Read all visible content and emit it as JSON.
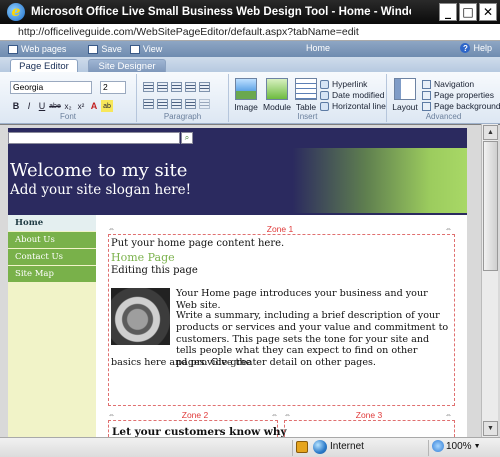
{
  "window": {
    "title": "Microsoft Office Live Small Business Web Design Tool - Home - Windows Internet Explorer",
    "controls": {
      "minimize": "_",
      "maximize": "□",
      "close": "✕"
    }
  },
  "address_bar": {
    "url": "http://officeliveguide.com/WebSitePageEditor/default.aspx?tabName=edit"
  },
  "app_toolbar": {
    "web_pages": "Web pages",
    "save": "Save",
    "view": "View",
    "page_name": "Home",
    "help": "Help"
  },
  "tabs": [
    {
      "label": "Page Editor",
      "active": true
    },
    {
      "label": "Site Designer",
      "active": false
    }
  ],
  "ribbon": {
    "font": {
      "family": "Georgia",
      "size": "2",
      "group_label": "Font",
      "buttons": [
        "B",
        "I",
        "U",
        "abe",
        "x₂",
        "x²",
        "A",
        "ab"
      ]
    },
    "paragraph": {
      "group_label": "Paragraph"
    },
    "insert": {
      "group_label": "Insert",
      "image": "Image",
      "module": "Module",
      "table": "Table",
      "hyperlink": "Hyperlink",
      "date_modified": "Date modified",
      "horizontal_line": "Horizontal line"
    },
    "advanced": {
      "group_label": "Advanced",
      "layout": "Layout",
      "navigation": "Navigation",
      "page_properties": "Page properties",
      "page_background": "Page background"
    }
  },
  "site": {
    "title": "Welcome to my site",
    "slogan": "Add your site slogan here!",
    "nav": [
      {
        "label": "Home",
        "selected": true
      },
      {
        "label": "About Us",
        "selected": false
      },
      {
        "label": "Contact Us",
        "selected": false
      },
      {
        "label": "Site Map",
        "selected": false
      }
    ],
    "zones": {
      "zone1": "Zone 1",
      "zone2": "Zone 2",
      "zone3": "Zone 3"
    },
    "zone1_content": {
      "placeholder": "Put your home page content here.",
      "heading": "Home Page",
      "subheading": "Editing this page",
      "para1": "Your Home page introduces your business and your Web site.",
      "para2_a": "Write a summary, including a brief description of your products or services and your value and commitment to customers. This page sets the tone for your site and tells people what they can expect to find on other pages. Give the",
      "para2_b": "basics here and provide greater detail on other pages."
    },
    "zone2_title": "Let your customers know why"
  },
  "status_bar": {
    "security_zone": "Internet",
    "zoom": "100%"
  },
  "colors": {
    "site_background": "#2b2a5f",
    "accent_green": "#79b14a",
    "zone_label": "#e03b3b"
  }
}
